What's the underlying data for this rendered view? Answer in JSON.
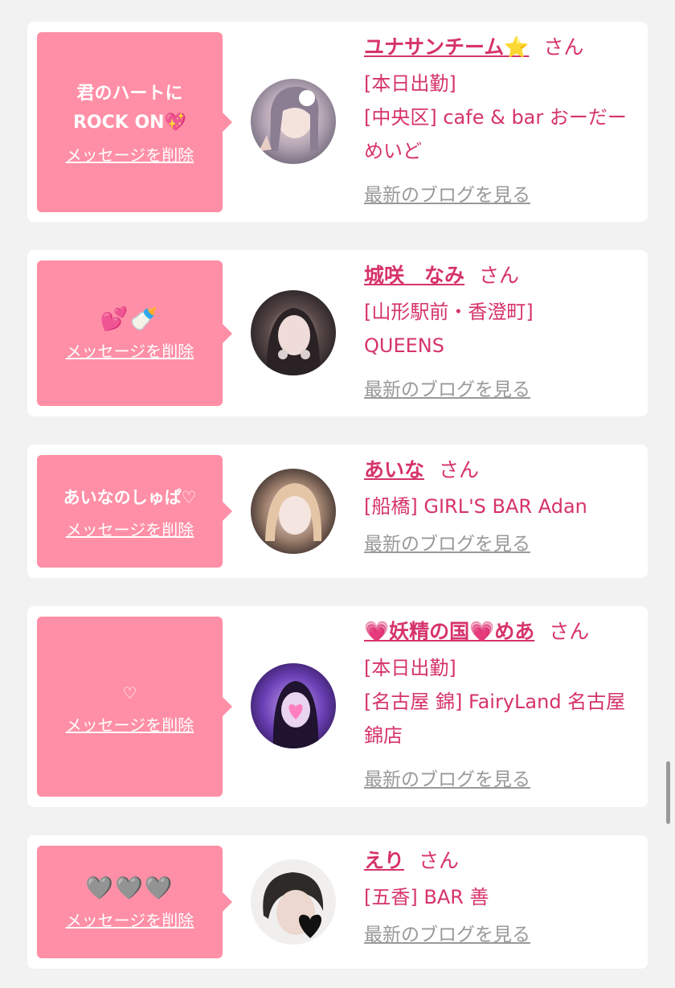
{
  "delete_label": "メッセージを削除",
  "blog_label": "最新のブログを見る",
  "honorific": "さん",
  "colors": {
    "accent": "#d6336c",
    "bubble": "#ff8fa6",
    "muted_link": "#999999",
    "background": "#f2f2f2"
  },
  "entries": [
    {
      "message": "君のハートに\nROCK ON💖",
      "name": "ユナサンチーム⭐",
      "status": "[本日出勤]",
      "shop": "[中央区] cafe & bar おーだーめいど",
      "avatar_icon": "profile-photo-icon"
    },
    {
      "message": "💕🍼",
      "name": "城咲　なみ",
      "status": "",
      "shop": "[山形駅前・香澄町] QUEENS",
      "avatar_icon": "profile-photo-icon"
    },
    {
      "message": "あいなのしゅぱ♡",
      "name": "あいな",
      "status": "",
      "shop": "[船橋] GIRL'S BAR Adan",
      "avatar_icon": "profile-photo-icon"
    },
    {
      "message": "♡",
      "name": "💗妖精の国💗めあ",
      "status": "[本日出勤]",
      "shop": "[名古屋 錦] FairyLand 名古屋錦店",
      "avatar_icon": "profile-photo-icon"
    },
    {
      "message": "🩶🩶🩶",
      "name": "えり",
      "status": "",
      "shop": "[五香] BAR 善",
      "avatar_icon": "profile-photo-icon"
    }
  ]
}
